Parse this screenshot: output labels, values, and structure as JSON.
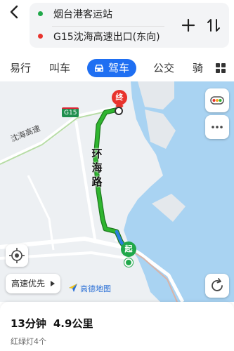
{
  "route": {
    "origin": "烟台港客运站",
    "destination": "G15沈海高速出口(东向)"
  },
  "tabs": [
    {
      "label": "易行"
    },
    {
      "label": "叫车"
    },
    {
      "label": "驾车"
    },
    {
      "label": "公交"
    },
    {
      "label": "骑"
    }
  ],
  "map": {
    "road_label": "沈海高速",
    "highway_shield": "G15",
    "route_road_name": [
      "环",
      "海",
      "路"
    ],
    "end_marker": "终",
    "start_marker": "起",
    "route_preference": "高速优先",
    "logo_text": "高德地图"
  },
  "summary": {
    "duration": "13分钟",
    "distance": "4.9公里",
    "traffic_lights": "红绿灯4个"
  },
  "colors": {
    "accent": "#1f6ff2",
    "route_green": "#2fb52f",
    "water": "#a9d3f2",
    "origin_dot": "#20a84a",
    "destination_dot": "#e8332d"
  },
  "icons": [
    "back-arrow-icon",
    "plus-icon",
    "swap-icon",
    "car-icon",
    "grid-icon",
    "traffic-light-icon",
    "more-icon",
    "locate-icon",
    "refresh-icon",
    "caret-right-icon",
    "amap-logo-icon"
  ]
}
